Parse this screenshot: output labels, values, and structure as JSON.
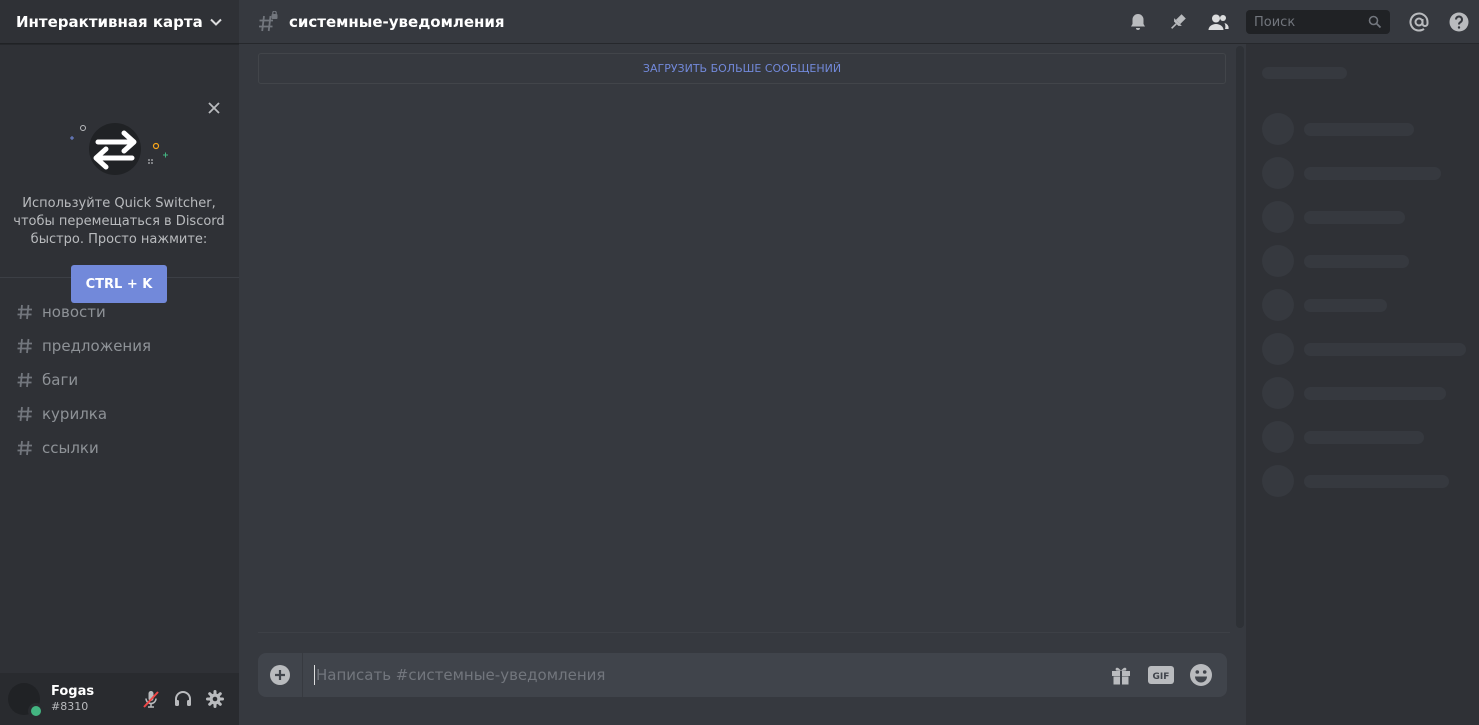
{
  "sidebar": {
    "server_name": "Интерактивная карта",
    "quick_switcher": {
      "text": "Используйте Quick Switcher, чтобы перемещаться в Discord быстро. Просто нажмите:",
      "shortcut": "CTRL + K"
    },
    "channels": [
      {
        "name": "новости"
      },
      {
        "name": "предложения"
      },
      {
        "name": "баги"
      },
      {
        "name": "курилка"
      },
      {
        "name": "ссылки"
      }
    ]
  },
  "user": {
    "name": "Fogas",
    "discriminator": "#8310",
    "status": "online",
    "status_color": "#43b581"
  },
  "header": {
    "channel_name": "системные-уведомления",
    "search_placeholder": "Поиск",
    "icons": [
      "bell-icon",
      "pin-icon",
      "members-icon",
      "mentions-icon",
      "help-icon"
    ]
  },
  "messages": {
    "load_more": "ЗАГРУЗИТЬ БОЛЬШЕ СООБЩЕНИЙ"
  },
  "composer": {
    "placeholder": "Написать #системные-уведомления",
    "icons": [
      "add-icon",
      "gift-icon",
      "gif-icon",
      "emoji-icon"
    ]
  },
  "colors": {
    "accent": "#7289da",
    "background": "#36393f",
    "sidebar": "#2f3136",
    "online": "#43b581"
  }
}
